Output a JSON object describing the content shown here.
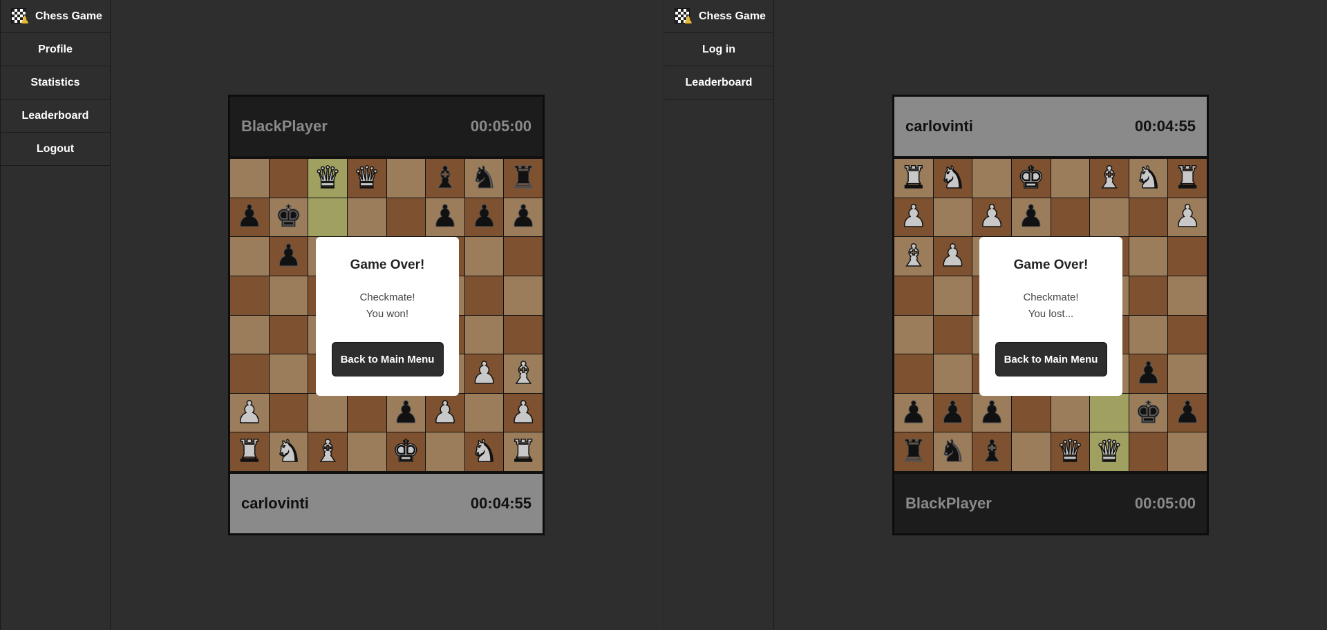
{
  "app_title": "Chess Game",
  "left": {
    "nav": [
      "Profile",
      "Statistics",
      "Leaderboard",
      "Logout"
    ],
    "top_player": {
      "name": "BlackPlayer",
      "time": "00:05:00"
    },
    "bottom_player": {
      "name": "carlovinti",
      "time": "00:04:55"
    },
    "modal": {
      "title": "Game Over!",
      "line1": "Checkmate!",
      "line2": "You won!",
      "button": "Back to Main Menu"
    },
    "board": [
      [
        "",
        "",
        "wQ",
        "wQ",
        "",
        "bB",
        "bN",
        "bR"
      ],
      [
        "bP",
        "bK",
        "",
        "",
        "",
        "bP",
        "bP",
        "bP"
      ],
      [
        "",
        "bP",
        "",
        "",
        "",
        "",
        "",
        ""
      ],
      [
        "",
        "",
        "",
        "",
        "",
        "",
        "",
        ""
      ],
      [
        "",
        "",
        "",
        "",
        "",
        "",
        "",
        ""
      ],
      [
        "",
        "",
        "",
        "",
        "",
        "",
        "wP",
        "wB"
      ],
      [
        "wP",
        "",
        "",
        "",
        "bP",
        "wP",
        "",
        "wP"
      ],
      [
        "wR",
        "wN",
        "wB",
        "",
        "wK",
        "",
        "wN",
        "wR"
      ]
    ],
    "highlights": [
      "0-2",
      "1-2"
    ]
  },
  "right": {
    "nav": [
      "Log in",
      "Leaderboard"
    ],
    "top_player": {
      "name": "carlovinti",
      "time": "00:04:55"
    },
    "bottom_player": {
      "name": "BlackPlayer",
      "time": "00:05:00"
    },
    "modal": {
      "title": "Game Over!",
      "line1": "Checkmate!",
      "line2": "You lost...",
      "button": "Back to Main Menu"
    },
    "board": [
      [
        "wR",
        "wN",
        "",
        "wK",
        "",
        "wB",
        "wN",
        "wR"
      ],
      [
        "wP",
        "",
        "wP",
        "bP",
        "",
        "",
        "",
        "wP"
      ],
      [
        "wB",
        "wP",
        "",
        "",
        "",
        "",
        "",
        ""
      ],
      [
        "",
        "",
        "",
        "",
        "",
        "",
        "",
        ""
      ],
      [
        "",
        "",
        "",
        "",
        "",
        "",
        "",
        ""
      ],
      [
        "",
        "",
        "",
        "",
        "",
        "",
        "bP",
        ""
      ],
      [
        "bP",
        "bP",
        "bP",
        "",
        "",
        "",
        "bK",
        "bP"
      ],
      [
        "bR",
        "bN",
        "bB",
        "",
        "wQ",
        "wQ",
        "",
        ""
      ]
    ],
    "highlights": [
      "6-5",
      "7-5"
    ]
  }
}
